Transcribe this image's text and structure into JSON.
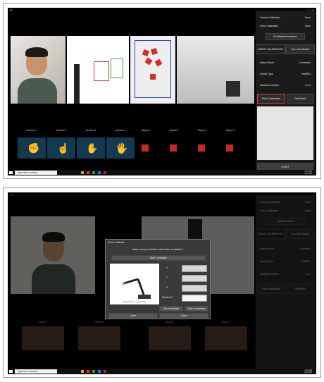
{
  "top": {
    "window_title": "IS",
    "side_panel": {
      "rows": [
        {
          "label": "Camera Calibration",
          "value": "Done"
        },
        {
          "label": "Robot Calibration",
          "value": "Done"
        }
      ],
      "fix_blocked_button": "Fix Blocked Hardware",
      "tabs": [
        "ROBOT CALIBRATION",
        "Live Cam Global"
      ],
      "status_rows": [
        {
          "label": "Status Robot",
          "value": "Connected"
        },
        {
          "label": "Device Type",
          "value": "SwiftPro"
        },
        {
          "label": "Hardware Version",
          "value": "3.3.1"
        }
      ],
      "robot_calibration_button": "Robot Calibration",
      "test_robot_button": "Test Robot",
      "start_button": "START"
    },
    "gesture_labels": [
      "Gesture 1",
      "Gesture 2",
      "Gesture 3",
      "Gesture 4"
    ],
    "object_labels": [
      "Object 1",
      "Object 2",
      "Object 3",
      "Object 4"
    ],
    "taskbar": {
      "search_placeholder": "Type here to search",
      "time": "9:41 AM",
      "date": "5/1/2020"
    }
  },
  "bottom": {
    "window_title": "IS",
    "side_panel": {
      "rows": [
        {
          "label": "Camera Calibration",
          "value": "Done"
        },
        {
          "label": "Robot Calibration",
          "value": "Done"
        }
      ],
      "fix_blocked_button": "Calibrate Robot",
      "tabs": [
        "ROBOT CALIBRATION",
        "Live Cam Global"
      ],
      "status_rows": [
        {
          "label": "Status Robot",
          "value": "Connected"
        },
        {
          "label": "Device Type",
          "value": "SwiftPro"
        },
        {
          "label": "Hardware Version",
          "value": "3.3.1"
        }
      ],
      "robot_calibration_button": "Robot Calibration",
      "test_robot_button": "Test Robot"
    },
    "dialog": {
      "title": "Robot Calibrate",
      "instruction": "Make sure you hold the robot while coordinate 0",
      "start_button": "Start Calibration",
      "fields": [
        "X",
        "Y",
        "Z",
        "Marker ID"
      ],
      "image_caption": "Drag points to coordinates",
      "set_coords_button": "Set Coordinate",
      "save_coords_button": "Save Coordinate",
      "done_button": "Done",
      "close_button": "Close"
    },
    "object_labels": [
      "Object 1",
      "Object 2",
      "Object 3",
      "Object 4"
    ],
    "taskbar": {
      "search_placeholder": "Type here to search",
      "time": "9:41 AM",
      "date": "5/1/2020"
    }
  }
}
